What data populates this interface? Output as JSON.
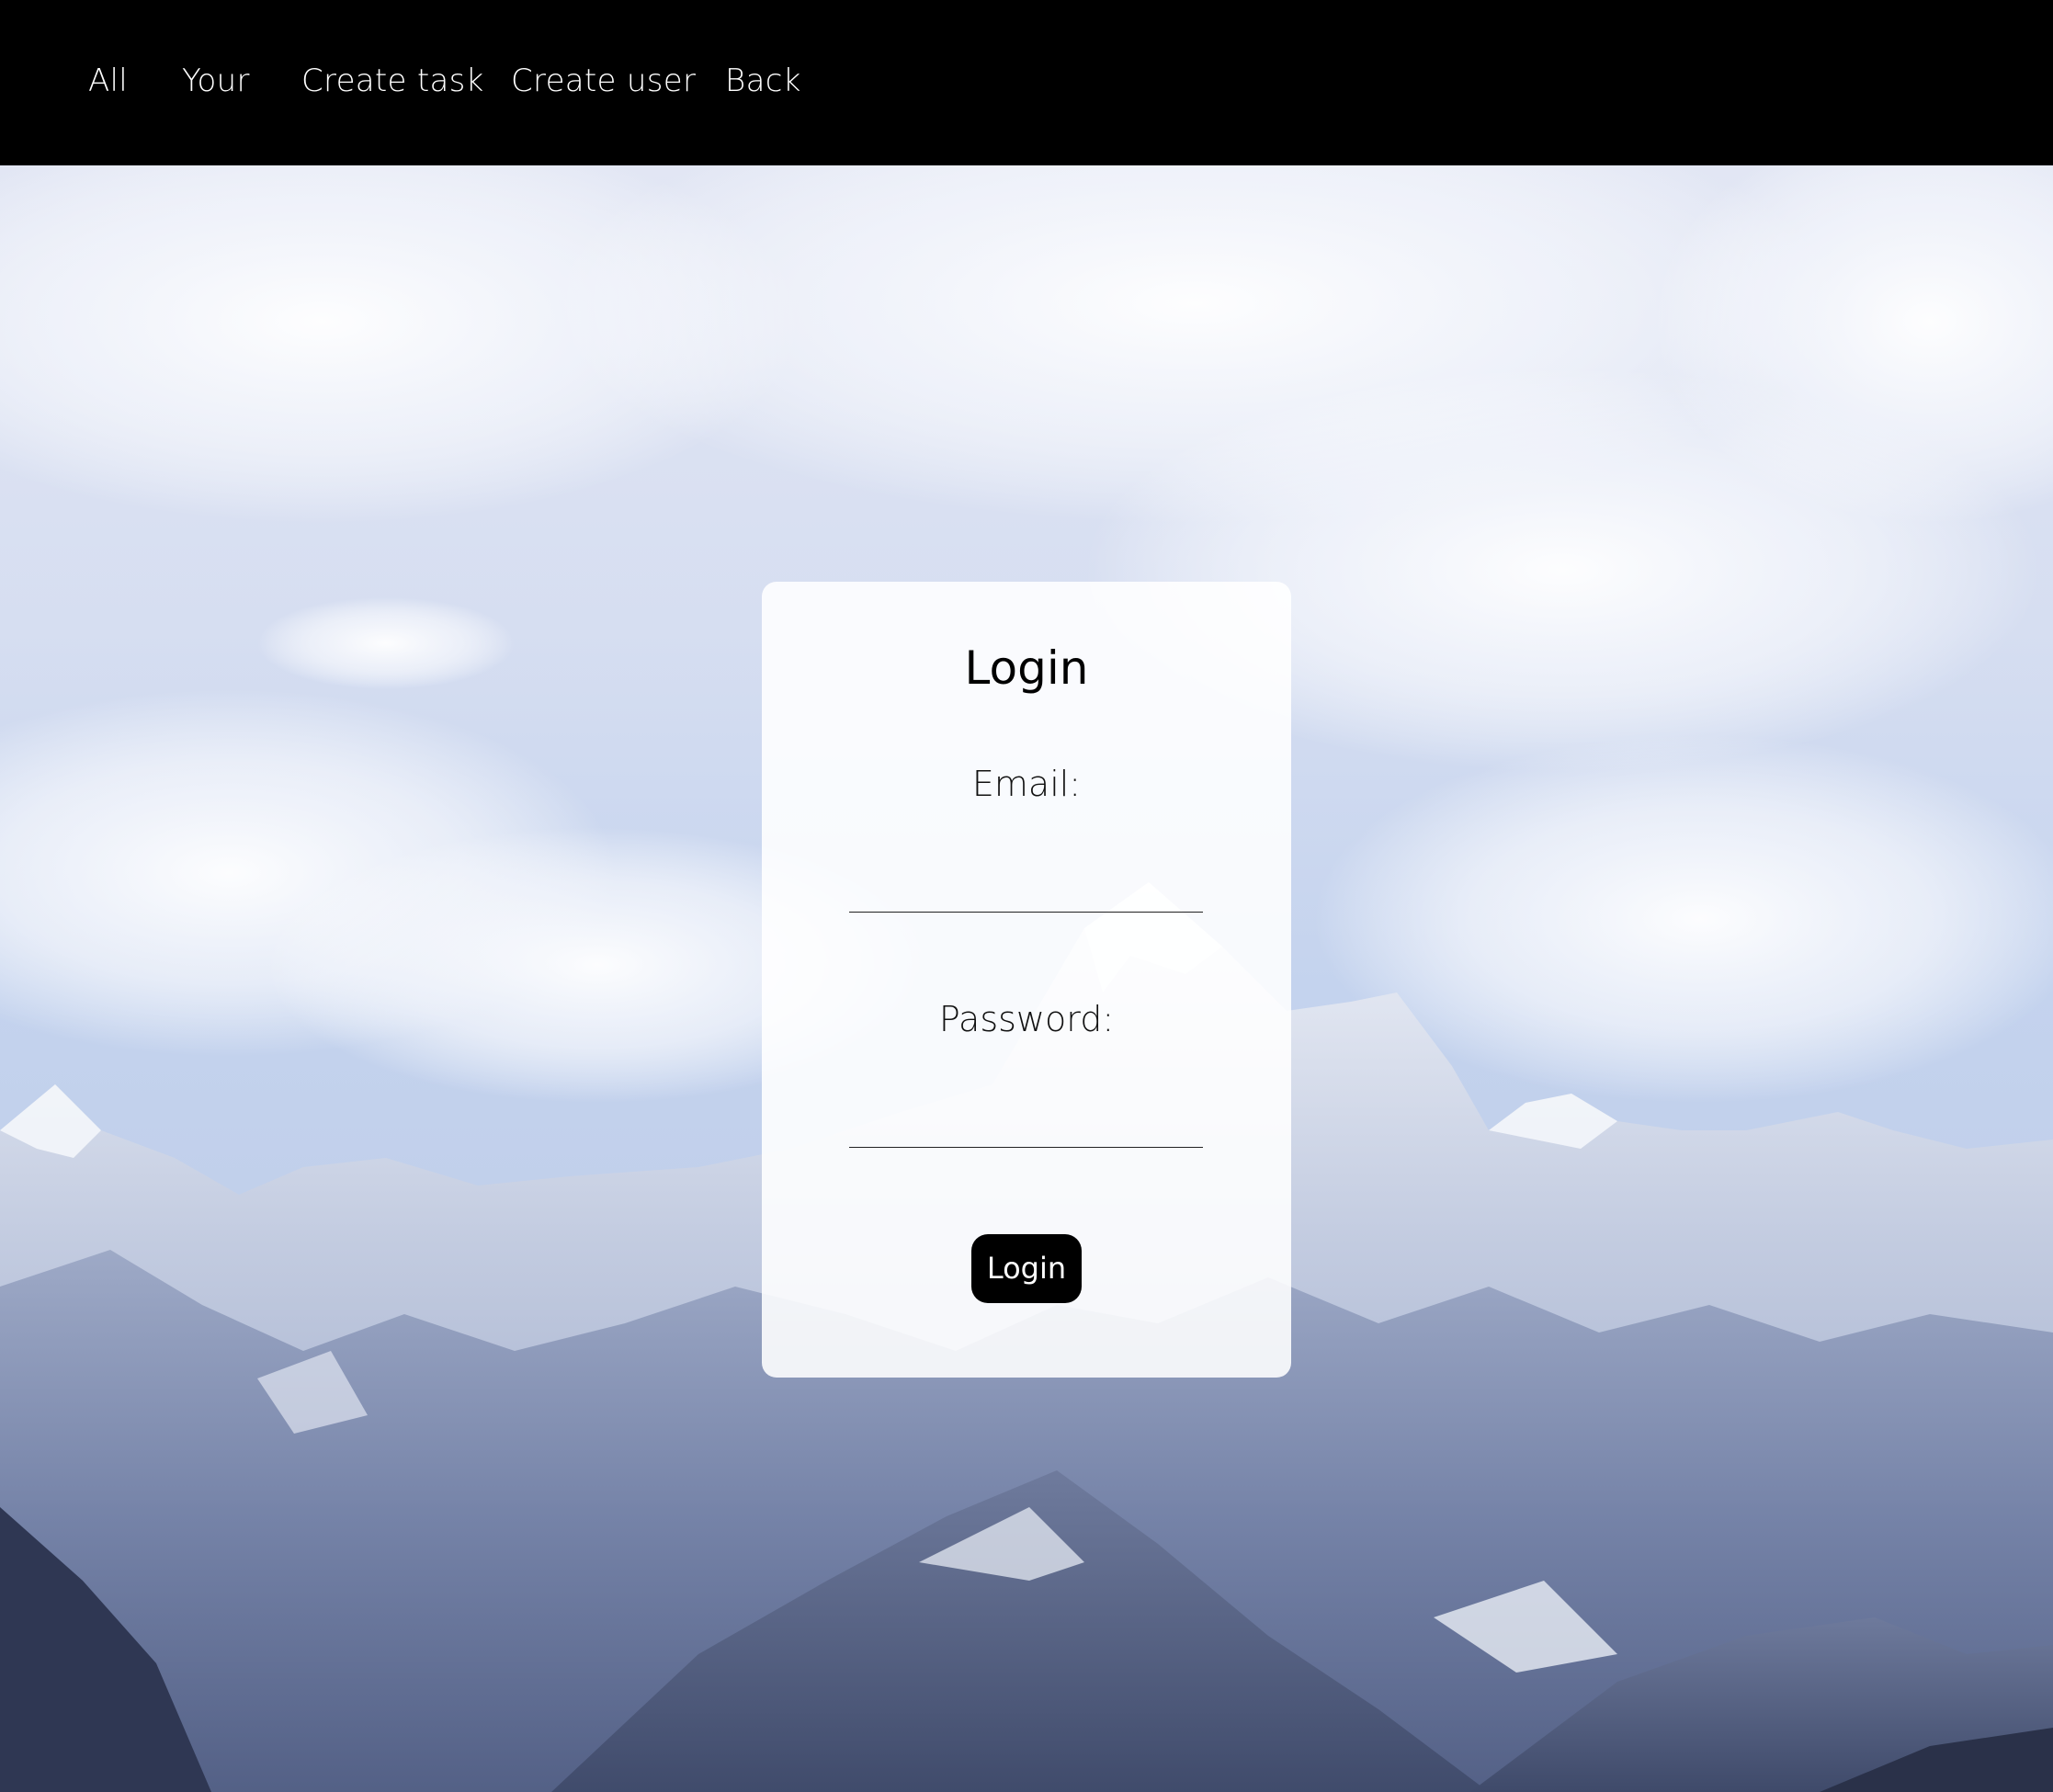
{
  "nav": {
    "items": [
      {
        "label": "All"
      },
      {
        "label": "Your"
      },
      {
        "label": "Create task"
      },
      {
        "label": "Create user"
      },
      {
        "label": "Back"
      }
    ]
  },
  "login": {
    "title": "Login",
    "email_label": "Email:",
    "email_value": "",
    "password_label": "Password:",
    "password_value": "",
    "submit_label": "Login"
  },
  "colors": {
    "nav_background": "#000000",
    "nav_text": "#ffffff",
    "card_background": "#ffffff",
    "button_background": "#000000",
    "button_text": "#ffffff"
  }
}
